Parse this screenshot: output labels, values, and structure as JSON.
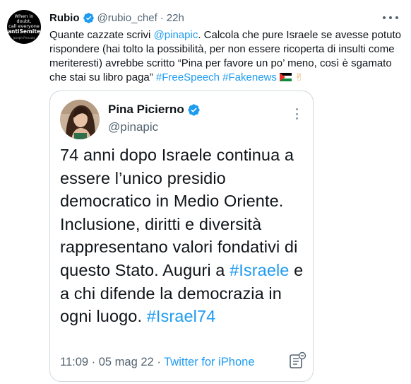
{
  "tweet": {
    "avatar": {
      "line1": "When in doubt,",
      "line2": "call everyone",
      "line3": "antiSemite",
      "line4": "Joseph Prescott"
    },
    "author_name": "Rubio",
    "author_handle": "@rubio_chef",
    "separator": "·",
    "time": "22h",
    "text_1": "Quante cazzate scrivi ",
    "mention": "@pinapic",
    "text_2": ". Calcola che pure Israele se avesse potuto rispondere (hai tolto la possibilità, per non essere ricoperta di insulti come meriteresti) avrebbe scritto “Pina per favore un po’ meno, così è sgamato che stai su libro paga” ",
    "hashtag_1": "#FreeSpeech",
    "hashtag_2": "#Fakenews",
    "peace_emoji": "✌",
    "colors": {
      "link": "#1d9bf0",
      "verified": "#1d9bf0",
      "secondary_text": "#536471",
      "border": "#cfd9de"
    }
  },
  "quoted": {
    "author_name": "Pina Picierno",
    "author_handle": "@pinapic",
    "text_1": "74 anni dopo Israele continua a essere l’unico presidio democratico in Medio Oriente. Inclusione, diritti e diversità rappresentano valori fondativi di questo Stato. Auguri a ",
    "hashtag_1": "#Israele",
    "text_2": " e a chi difende la democrazia in ogni luogo. ",
    "hashtag_2": "#Israel74",
    "time": "11:09",
    "separator_1": " · ",
    "date": "05 mag 22",
    "separator_2": " · ",
    "source": "Twitter for iPhone"
  },
  "icons": {
    "verified": "verified-badge-icon",
    "more": "more-options-icon",
    "flag": "palestine-flag-icon",
    "notes": "community-notes-icon"
  }
}
